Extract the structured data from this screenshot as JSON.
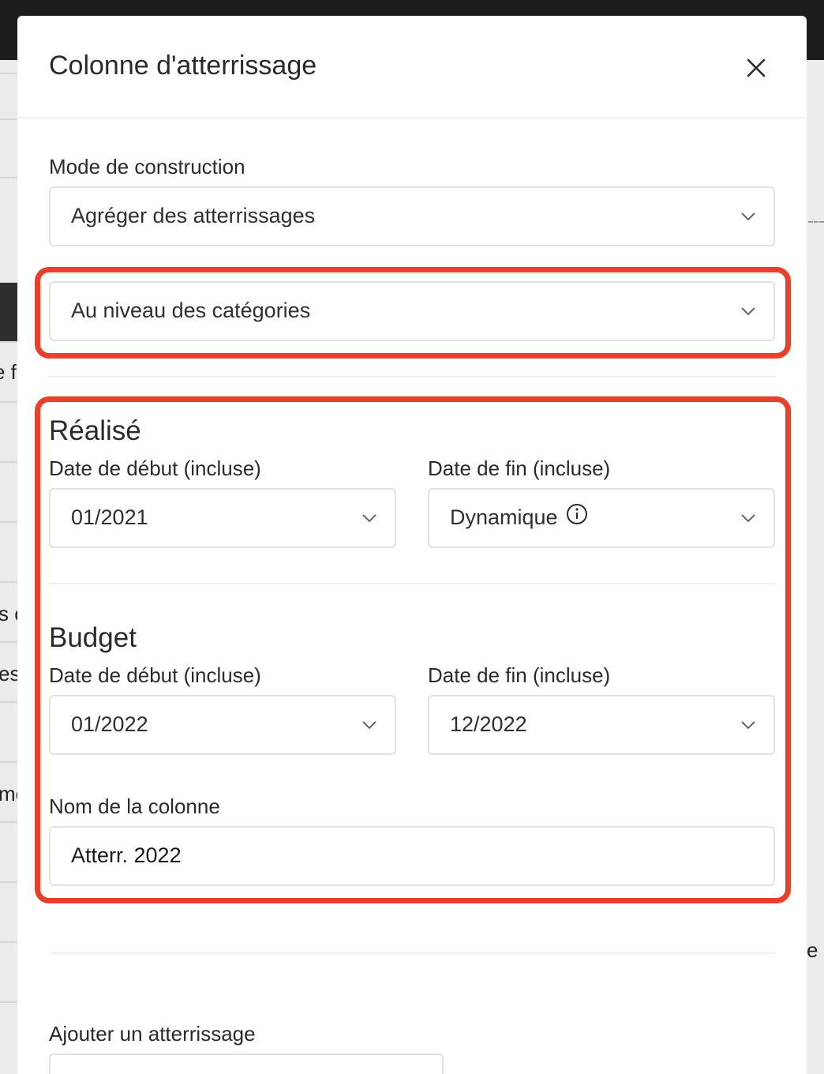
{
  "background": {
    "left_fragments": [
      "e f",
      "s c",
      "es",
      "mo"
    ],
    "right_fragment": "e"
  },
  "modal": {
    "title": "Colonne d'atterrissage",
    "close_icon": "close-icon"
  },
  "construction": {
    "label": "Mode de construction",
    "value": "Agréger des atterrissages"
  },
  "level": {
    "value": "Au niveau des catégories"
  },
  "realise": {
    "title": "Réalisé",
    "start_label": "Date de début (incluse)",
    "start_value": "01/2021",
    "end_label": "Date de fin (incluse)",
    "end_value": "Dynamique",
    "end_icon": "info-icon"
  },
  "budget": {
    "title": "Budget",
    "start_label": "Date de début (incluse)",
    "start_value": "01/2022",
    "end_label": "Date de fin (incluse)",
    "end_value": "12/2022"
  },
  "column_name": {
    "label": "Nom de la colonne",
    "value": "Atterr. 2022"
  },
  "add_landing": {
    "label": "Ajouter un atterrissage"
  },
  "colors": {
    "highlight": "#e8402a",
    "border": "#e2e2e2",
    "topbar": "#1c1c1e"
  }
}
